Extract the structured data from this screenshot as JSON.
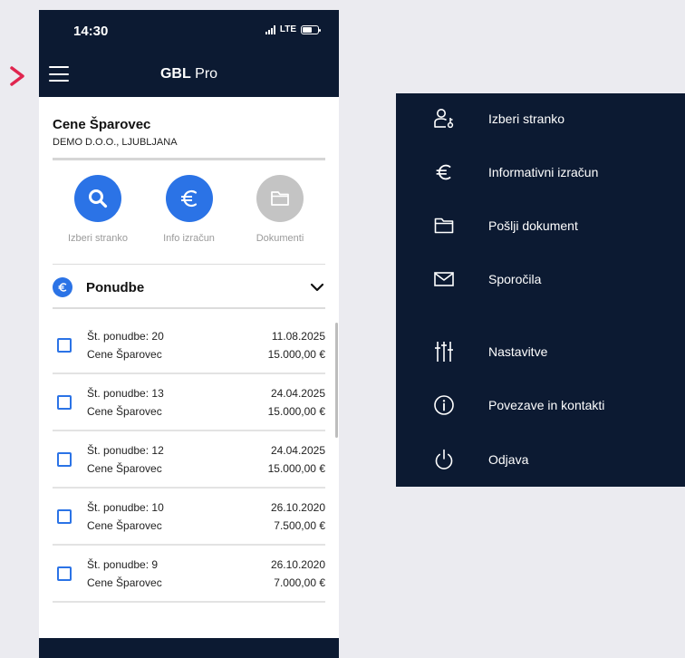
{
  "status": {
    "time": "14:30",
    "network": "LTE"
  },
  "app": {
    "title_bold": "GBL",
    "title_rest": " Pro"
  },
  "client": {
    "name": "Cene Šparovec",
    "company": "DEMO D.O.O., LJUBLJANA"
  },
  "actions": [
    {
      "label": "Izberi stranko",
      "icon": "search-icon",
      "color": "#2b73e6"
    },
    {
      "label": "Info izračun",
      "icon": "euro-icon",
      "color": "#2b73e6"
    },
    {
      "label": "Dokumenti",
      "icon": "folder-icon",
      "color": "#c4c4c4"
    }
  ],
  "section": {
    "title": "Ponudbe"
  },
  "offers": [
    {
      "number": "Št. ponudbe: 20",
      "client": "Cene Šparovec",
      "date": "11.08.2025",
      "amount": "15.000,00 €"
    },
    {
      "number": "Št. ponudbe: 13",
      "client": "Cene Šparovec",
      "date": "24.04.2025",
      "amount": "15.000,00 €"
    },
    {
      "number": "Št. ponudbe: 12",
      "client": "Cene Šparovec",
      "date": "24.04.2025",
      "amount": "15.000,00 €"
    },
    {
      "number": "Št. ponudbe: 10",
      "client": "Cene Šparovec",
      "date": "26.10.2020",
      "amount": "7.500,00 €"
    },
    {
      "number": "Št. ponudbe: 9",
      "client": "Cene Šparovec",
      "date": "26.10.2020",
      "amount": "7.000,00 €"
    }
  ],
  "menu": [
    {
      "label": "Izberi stranko",
      "icon": "user-key-icon"
    },
    {
      "label": "Informativni izračun",
      "icon": "euro-icon"
    },
    {
      "label": "Pošlji dokument",
      "icon": "folder-icon"
    },
    {
      "label": "Sporočila",
      "icon": "mail-icon"
    },
    {
      "label": "Nastavitve",
      "icon": "sliders-icon"
    },
    {
      "label": "Povezave in kontakti",
      "icon": "info-icon"
    },
    {
      "label": "Odjava",
      "icon": "power-icon"
    }
  ],
  "colors": {
    "navy": "#0c1a32",
    "accent": "#2b73e6",
    "pointer": "#e0254f"
  }
}
